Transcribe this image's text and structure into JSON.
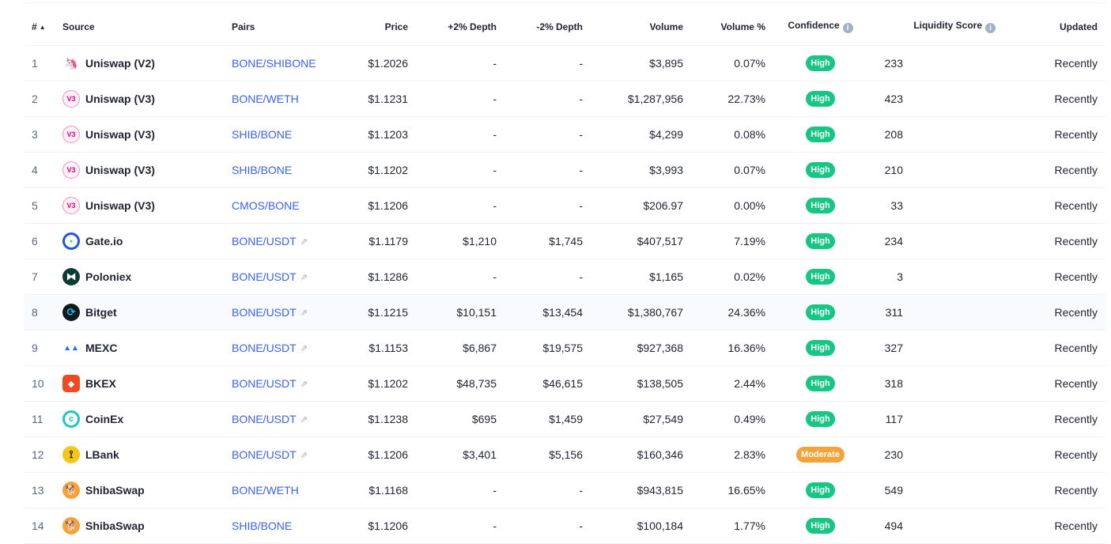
{
  "colors": {
    "high": "#16c784",
    "moderate": "#f2a33a",
    "link": "#3861fb"
  },
  "headers": {
    "rank": "#",
    "rank_sort_icon": "▲",
    "source": "Source",
    "pairs": "Pairs",
    "price": "Price",
    "depth_plus": "+2% Depth",
    "depth_minus": "-2% Depth",
    "volume": "Volume",
    "volume_pct": "Volume %",
    "confidence": "Confidence",
    "liquidity": "Liquidity Score",
    "updated": "Updated"
  },
  "rows": [
    {
      "rank": "1",
      "source": "Uniswap (V2)",
      "icon": "uniswap-v2-icon",
      "pair": "BONE/SHIBONE",
      "external": false,
      "price": "$1.2026",
      "depth_plus": "-",
      "depth_minus": "-",
      "volume": "$3,895",
      "volume_pct": "0.07%",
      "confidence": "High",
      "liquidity": "233",
      "updated": "Recently"
    },
    {
      "rank": "2",
      "source": "Uniswap (V3)",
      "icon": "uniswap-v3-icon",
      "pair": "BONE/WETH",
      "external": false,
      "price": "$1.1231",
      "depth_plus": "-",
      "depth_minus": "-",
      "volume": "$1,287,956",
      "volume_pct": "22.73%",
      "confidence": "High",
      "liquidity": "423",
      "updated": "Recently"
    },
    {
      "rank": "3",
      "source": "Uniswap (V3)",
      "icon": "uniswap-v3-icon",
      "pair": "SHIB/BONE",
      "external": false,
      "price": "$1.1203",
      "depth_plus": "-",
      "depth_minus": "-",
      "volume": "$4,299",
      "volume_pct": "0.08%",
      "confidence": "High",
      "liquidity": "208",
      "updated": "Recently"
    },
    {
      "rank": "4",
      "source": "Uniswap (V3)",
      "icon": "uniswap-v3-icon",
      "pair": "SHIB/BONE",
      "external": false,
      "price": "$1.1202",
      "depth_plus": "-",
      "depth_minus": "-",
      "volume": "$3,993",
      "volume_pct": "0.07%",
      "confidence": "High",
      "liquidity": "210",
      "updated": "Recently"
    },
    {
      "rank": "5",
      "source": "Uniswap (V3)",
      "icon": "uniswap-v3-icon",
      "pair": "CMOS/BONE",
      "external": false,
      "price": "$1.1206",
      "depth_plus": "-",
      "depth_minus": "-",
      "volume": "$206.97",
      "volume_pct": "0.00%",
      "confidence": "High",
      "liquidity": "33",
      "updated": "Recently"
    },
    {
      "rank": "6",
      "source": "Gate.io",
      "icon": "gate-io-icon",
      "pair": "BONE/USDT",
      "external": true,
      "price": "$1.1179",
      "depth_plus": "$1,210",
      "depth_minus": "$1,745",
      "volume": "$407,517",
      "volume_pct": "7.19%",
      "confidence": "High",
      "liquidity": "234",
      "updated": "Recently"
    },
    {
      "rank": "7",
      "source": "Poloniex",
      "icon": "poloniex-icon",
      "pair": "BONE/USDT",
      "external": true,
      "price": "$1.1286",
      "depth_plus": "-",
      "depth_minus": "-",
      "volume": "$1,165",
      "volume_pct": "0.02%",
      "confidence": "High",
      "liquidity": "3",
      "updated": "Recently"
    },
    {
      "rank": "8",
      "source": "Bitget",
      "icon": "bitget-icon",
      "pair": "BONE/USDT",
      "external": true,
      "price": "$1.1215",
      "depth_plus": "$10,151",
      "depth_minus": "$13,454",
      "volume": "$1,380,767",
      "volume_pct": "24.36%",
      "confidence": "High",
      "liquidity": "311",
      "updated": "Recently"
    },
    {
      "rank": "9",
      "source": "MEXC",
      "icon": "mexc-icon",
      "pair": "BONE/USDT",
      "external": true,
      "price": "$1.1153",
      "depth_plus": "$6,867",
      "depth_minus": "$19,575",
      "volume": "$927,368",
      "volume_pct": "16.36%",
      "confidence": "High",
      "liquidity": "327",
      "updated": "Recently"
    },
    {
      "rank": "10",
      "source": "BKEX",
      "icon": "bkex-icon",
      "pair": "BONE/USDT",
      "external": true,
      "price": "$1.1202",
      "depth_plus": "$48,735",
      "depth_minus": "$46,615",
      "volume": "$138,505",
      "volume_pct": "2.44%",
      "confidence": "High",
      "liquidity": "318",
      "updated": "Recently"
    },
    {
      "rank": "11",
      "source": "CoinEx",
      "icon": "coinex-icon",
      "pair": "BONE/USDT",
      "external": true,
      "price": "$1.1238",
      "depth_plus": "$695",
      "depth_minus": "$1,459",
      "volume": "$27,549",
      "volume_pct": "0.49%",
      "confidence": "High",
      "liquidity": "117",
      "updated": "Recently"
    },
    {
      "rank": "12",
      "source": "LBank",
      "icon": "lbank-icon",
      "pair": "BONE/USDT",
      "external": true,
      "price": "$1.1206",
      "depth_plus": "$3,401",
      "depth_minus": "$5,156",
      "volume": "$160,346",
      "volume_pct": "2.83%",
      "confidence": "Moderate",
      "liquidity": "230",
      "updated": "Recently"
    },
    {
      "rank": "13",
      "source": "ShibaSwap",
      "icon": "shibaswap-icon",
      "pair": "BONE/WETH",
      "external": false,
      "price": "$1.1168",
      "depth_plus": "-",
      "depth_minus": "-",
      "volume": "$943,815",
      "volume_pct": "16.65%",
      "confidence": "High",
      "liquidity": "549",
      "updated": "Recently"
    },
    {
      "rank": "14",
      "source": "ShibaSwap",
      "icon": "shibaswap-icon",
      "pair": "SHIB/BONE",
      "external": false,
      "price": "$1.1206",
      "depth_plus": "-",
      "depth_minus": "-",
      "volume": "$100,184",
      "volume_pct": "1.77%",
      "confidence": "High",
      "liquidity": "494",
      "updated": "Recently"
    }
  ]
}
